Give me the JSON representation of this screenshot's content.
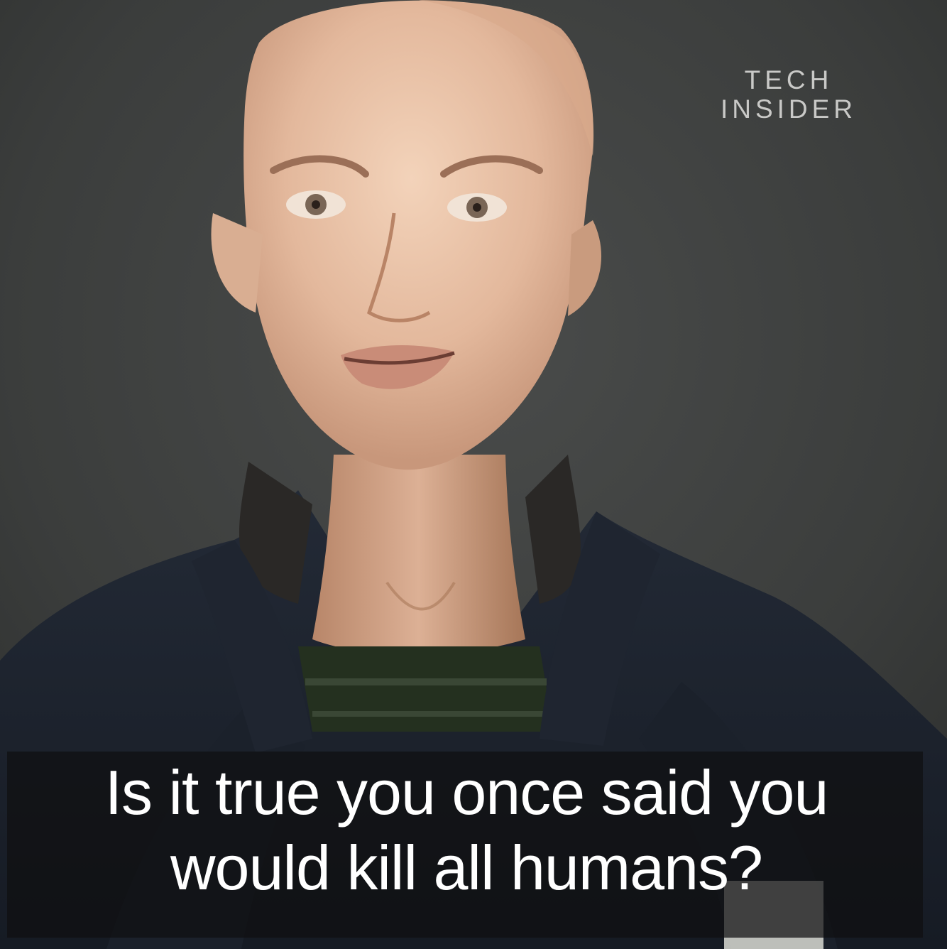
{
  "video": {
    "watermark": {
      "line1": "TECH",
      "line2": "INSIDER"
    },
    "caption": {
      "line1": "Is it true you once said you",
      "line2": "would kill all humans?"
    }
  },
  "colors": {
    "background": "#3b3d3c",
    "caption_text": "#ffffff",
    "caption_box": "#0f0f10",
    "watermark": "#c9c9c7"
  }
}
